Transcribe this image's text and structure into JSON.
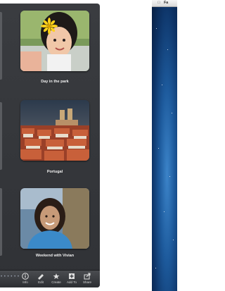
{
  "events": [
    {
      "title": "Day in the park"
    },
    {
      "title": "Portugal"
    },
    {
      "title": "Weekend with Vivian"
    }
  ],
  "toolbar": {
    "buttons": [
      {
        "label": "Info",
        "icon": "info-icon"
      },
      {
        "label": "Edit",
        "icon": "edit-icon"
      },
      {
        "label": "Create",
        "icon": "create-icon"
      },
      {
        "label": "Add To",
        "icon": "add-to-icon"
      },
      {
        "label": "Share",
        "icon": "share-icon"
      }
    ]
  },
  "desktop": {
    "menubar": {
      "apple": "",
      "app": "Fa"
    }
  }
}
